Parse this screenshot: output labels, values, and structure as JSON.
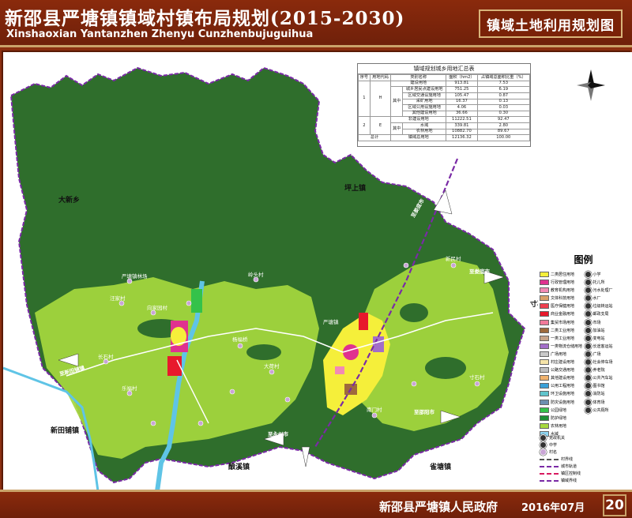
{
  "header": {
    "title_cn": "新邵县严塘镇镇域村镇布局规划(2015-2030)",
    "title_en": "Xinshaoxian Yantanzhen Zhenyu Cunzhenbujuguihua",
    "map_title": "镇域土地利用规划图"
  },
  "footer": {
    "government": "新邵县严塘镇人民政府",
    "date": "2016年07月",
    "page": "20"
  },
  "summary_table": {
    "title": "镇域规划城乡用地汇总表",
    "headers": [
      "序号",
      "用地代码",
      "类别名称",
      "面积（hm2）",
      "占镇域总面积比重（%）"
    ],
    "group_label": "其中",
    "rows": [
      {
        "no": "1",
        "code": "H",
        "name": "建设用地",
        "area": "913.81",
        "pct": "7.53"
      },
      {
        "no": "",
        "code": "",
        "name": "城乡居民点建设用地",
        "area": "751.25",
        "pct": "6.19"
      },
      {
        "no": "",
        "code": "",
        "name": "区域交通设施用地",
        "area": "105.47",
        "pct": "0.87"
      },
      {
        "no": "",
        "code": "",
        "name": "采矿用地",
        "area": "16.37",
        "pct": "0.13"
      },
      {
        "no": "",
        "code": "",
        "name": "区域公用设施用地",
        "area": "4.06",
        "pct": "0.03"
      },
      {
        "no": "",
        "code": "",
        "name": "其他建设用地",
        "area": "36.66",
        "pct": "0.30"
      },
      {
        "no": "2",
        "code": "E",
        "name": "非建设用地",
        "area": "11222.51",
        "pct": "92.47"
      },
      {
        "no": "",
        "code": "",
        "name": "水域",
        "area": "339.81",
        "pct": "2.80"
      },
      {
        "no": "",
        "code": "",
        "name": "农林用地",
        "area": "10882.70",
        "pct": "89.67"
      },
      {
        "no": "总计",
        "code": "",
        "name": "镇域总用地",
        "area": "12136.32",
        "pct": "100.00"
      }
    ]
  },
  "legend": {
    "title": "图例",
    "landuse": [
      {
        "label": "二类居住用地",
        "color": "#f5ef3a"
      },
      {
        "label": "行政管理用地",
        "color": "#e0318f"
      },
      {
        "label": "教育机构用地",
        "color": "#f28ab4"
      },
      {
        "label": "文体科技用地",
        "color": "#d8a06a"
      },
      {
        "label": "医疗保健用地",
        "color": "#ee3f4f"
      },
      {
        "label": "商业金融用地",
        "color": "#e8192c"
      },
      {
        "label": "集贸市场用地",
        "color": "#f07a9a"
      },
      {
        "label": "二类工业用地",
        "color": "#9e6a3c"
      },
      {
        "label": "一类工业用地",
        "color": "#c7a48a"
      },
      {
        "label": "一类物流仓储用地",
        "color": "#a36ec9"
      },
      {
        "label": "广场用地",
        "color": "#c9c9c9"
      },
      {
        "label": "村庄建设用地",
        "color": "#f6e4a8"
      },
      {
        "label": "公路交通用地",
        "color": "#bfbfbf"
      },
      {
        "label": "其他建设用地",
        "color": "#f0b26d"
      },
      {
        "label": "公用工程用地",
        "color": "#3aa0d8"
      },
      {
        "label": "环卫设施用地",
        "color": "#5fc4cc"
      },
      {
        "label": "防灾设施用地",
        "color": "#6d8fb0"
      },
      {
        "label": "公园绿地",
        "color": "#34c24a"
      },
      {
        "label": "防护绿地",
        "color": "#1e8f35"
      },
      {
        "label": "农林用地",
        "color": "#a6d83e"
      },
      {
        "label": "水域",
        "color": "#8fd6f2"
      }
    ],
    "facilities": [
      "小学",
      "托儿所",
      "污水处理厂",
      "水厂",
      "垃圾转运站",
      "邮政支局",
      "市场",
      "加油站",
      "变电站",
      "长途客运站",
      "广场",
      "社会停车场",
      "养老院",
      "公共汽车站",
      "图书馆",
      "消防站",
      "体育场",
      "公共厕所"
    ],
    "misc": [
      "党政机关",
      "中学",
      "村名"
    ],
    "lines": [
      {
        "label": "村界线",
        "color": "#555555"
      },
      {
        "label": "城市轨道",
        "color": "#7a2aa6"
      },
      {
        "label": "镇区控制线",
        "color": "#d81b60"
      },
      {
        "label": "镇域界线",
        "color": "#7a2aa6"
      }
    ]
  },
  "places": {
    "neighbors": [
      "大新乡",
      "坪上镇",
      "寸石镇",
      "新田铺镇",
      "酿溪镇",
      "雀塘镇"
    ],
    "villages": [
      "严塘镇林场",
      "向家园村",
      "汪家村",
      "严塘镇",
      "岭头村",
      "杨福桥",
      "大荷村",
      "乐福村",
      "长石村",
      "江家村",
      "花林村",
      "新田铺村",
      "东风村",
      "白云村",
      "大坪村",
      "兰家村",
      "南门村",
      "新民村",
      "湖汗村",
      "寸石村"
    ],
    "directions": [
      "至新田铺镇",
      "至永州市",
      "至邵阳市",
      "至娄底市",
      "至娄底市",
      "至邵阳市"
    ]
  },
  "colors": {
    "forest": "#2f6e2c",
    "agri": "#a6d83e",
    "residential": "#f5ef3a",
    "rail": "#7a2aa6",
    "river": "#5fc4e6",
    "frame": "#8a2a0c"
  }
}
